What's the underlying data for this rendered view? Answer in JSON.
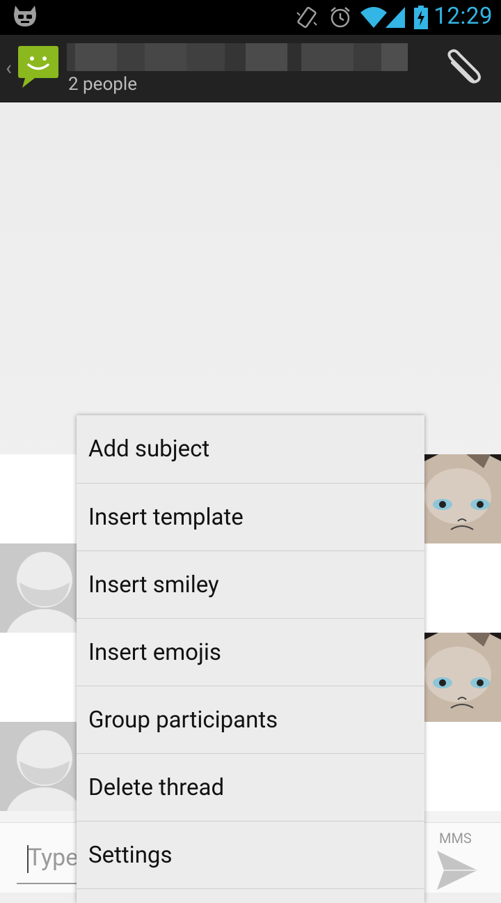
{
  "status_bar": {
    "icons": [
      "cyanogenmod-robot-icon",
      "vibrate-icon",
      "alarm-icon",
      "wifi-icon",
      "cell-signal-icon",
      "battery-charging-icon"
    ],
    "time": "12:29",
    "accent": "#33b5e5"
  },
  "action_bar": {
    "app_icon": "messaging-icon",
    "title_redacted": true,
    "subtitle": "2 people",
    "attach_icon": "paperclip-icon"
  },
  "compose": {
    "placeholder": "Type",
    "mms_label": "MMS",
    "send_icon": "send-icon"
  },
  "overflow_menu": {
    "items": [
      "Add subject",
      "Insert template",
      "Insert smiley",
      "Insert emojis",
      "Group participants",
      "Delete thread",
      "Settings"
    ]
  }
}
